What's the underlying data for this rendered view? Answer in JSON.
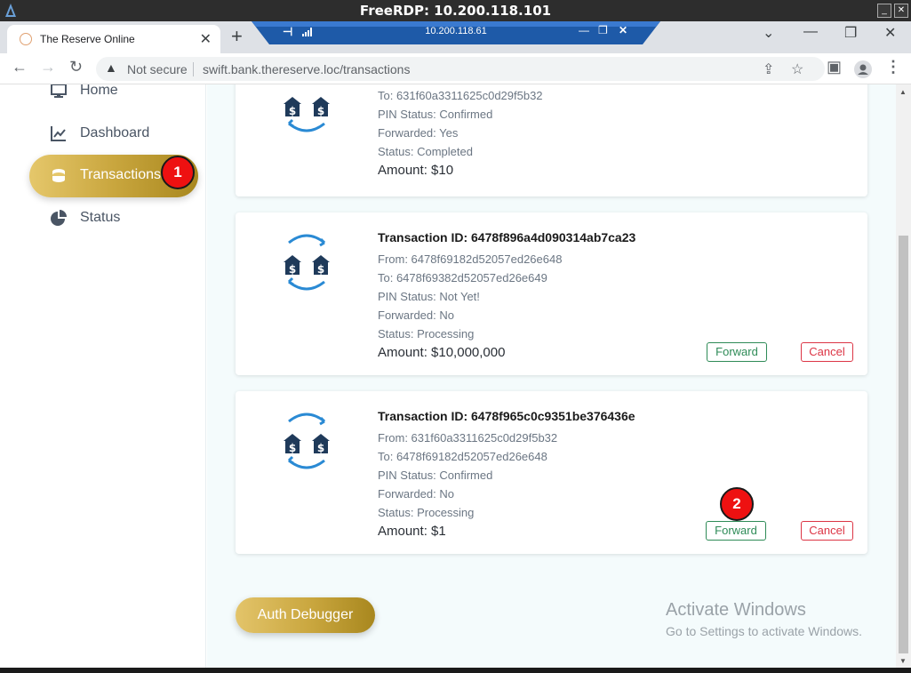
{
  "rdp": {
    "title": "FreeRDP: 10.200.118.101"
  },
  "browser": {
    "tab_title": "The Reserve Online",
    "new_tab": "+",
    "connection_label": "10.200.118.61",
    "security_label": "Not secure",
    "url_host": "swift.bank.thereserve.loc",
    "url_path": "/transactions"
  },
  "sidebar": {
    "items": [
      {
        "label": "Home",
        "icon": "monitor-icon",
        "active": false
      },
      {
        "label": "Dashboard",
        "icon": "chart-line-icon",
        "active": false
      },
      {
        "label": "Transactions",
        "icon": "coins-icon",
        "active": true
      },
      {
        "label": "Status",
        "icon": "pie-chart-icon",
        "active": false
      }
    ]
  },
  "annotations": {
    "badge1": "1",
    "badge2": "2"
  },
  "transactions": [
    {
      "id_line": "",
      "to": "To: 631f60a3311625c0d29f5b32",
      "pin": "PIN Status: Confirmed",
      "forwarded": "Forwarded: Yes",
      "status": "Status: Completed",
      "amount": "Amount: $10"
    },
    {
      "id_line": "Transaction ID: 6478f896a4d090314ab7ca23",
      "from": "From: 6478f69182d52057ed26e648",
      "to": "To: 6478f69382d52057ed26e649",
      "pin": "PIN Status: Not Yet!",
      "forwarded": "Forwarded: No",
      "status": "Status: Processing",
      "amount": "Amount: $10,000,000",
      "forward_label": "Forward",
      "cancel_label": "Cancel"
    },
    {
      "id_line": "Transaction ID: 6478f965c0c9351be376436e",
      "from": "From: 631f60a3311625c0d29f5b32",
      "to": "To: 6478f69182d52057ed26e648",
      "pin": "PIN Status: Confirmed",
      "forwarded": "Forwarded: No",
      "status": "Status: Processing",
      "amount": "Amount: $1",
      "forward_label": "Forward",
      "cancel_label": "Cancel"
    }
  ],
  "auth_debugger_label": "Auth Debugger",
  "watermark": {
    "title": "Activate Windows",
    "subtitle": "Go to Settings to activate Windows."
  },
  "colors": {
    "gold_accent": "#c9a63e",
    "forward_green": "#2e8b57",
    "cancel_red": "#dc3545",
    "icon_navy": "#1f3a5a",
    "icon_blue": "#2a8ad4"
  }
}
